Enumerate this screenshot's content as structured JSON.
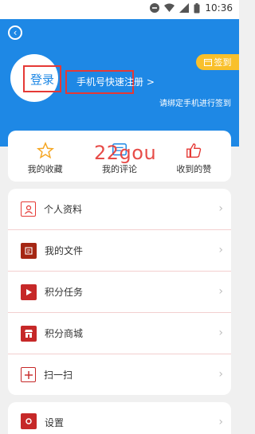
{
  "status": {
    "time": "10:36"
  },
  "header": {
    "login_label": "登录",
    "register_label": "手机号快速注册 >",
    "signin_label": "签到",
    "signin_tip": "请绑定手机进行签到"
  },
  "quick": [
    {
      "label": "我的收藏",
      "icon": "star-icon"
    },
    {
      "label": "我的评论",
      "icon": "comment-icon"
    },
    {
      "label": "收到的赞",
      "icon": "thumbs-up-icon"
    }
  ],
  "watermark": "22gou",
  "menu": [
    {
      "label": "个人资料",
      "icon": "profile-icon"
    },
    {
      "label": "我的文件",
      "icon": "file-icon"
    },
    {
      "label": "积分任务",
      "icon": "flag-icon"
    },
    {
      "label": "积分商城",
      "icon": "store-icon"
    },
    {
      "label": "扫一扫",
      "icon": "scan-icon"
    }
  ],
  "settings_label": "设置",
  "colors": {
    "primary": "#1e88e5",
    "accent": "#e53935",
    "gold": "#f9c02b"
  }
}
